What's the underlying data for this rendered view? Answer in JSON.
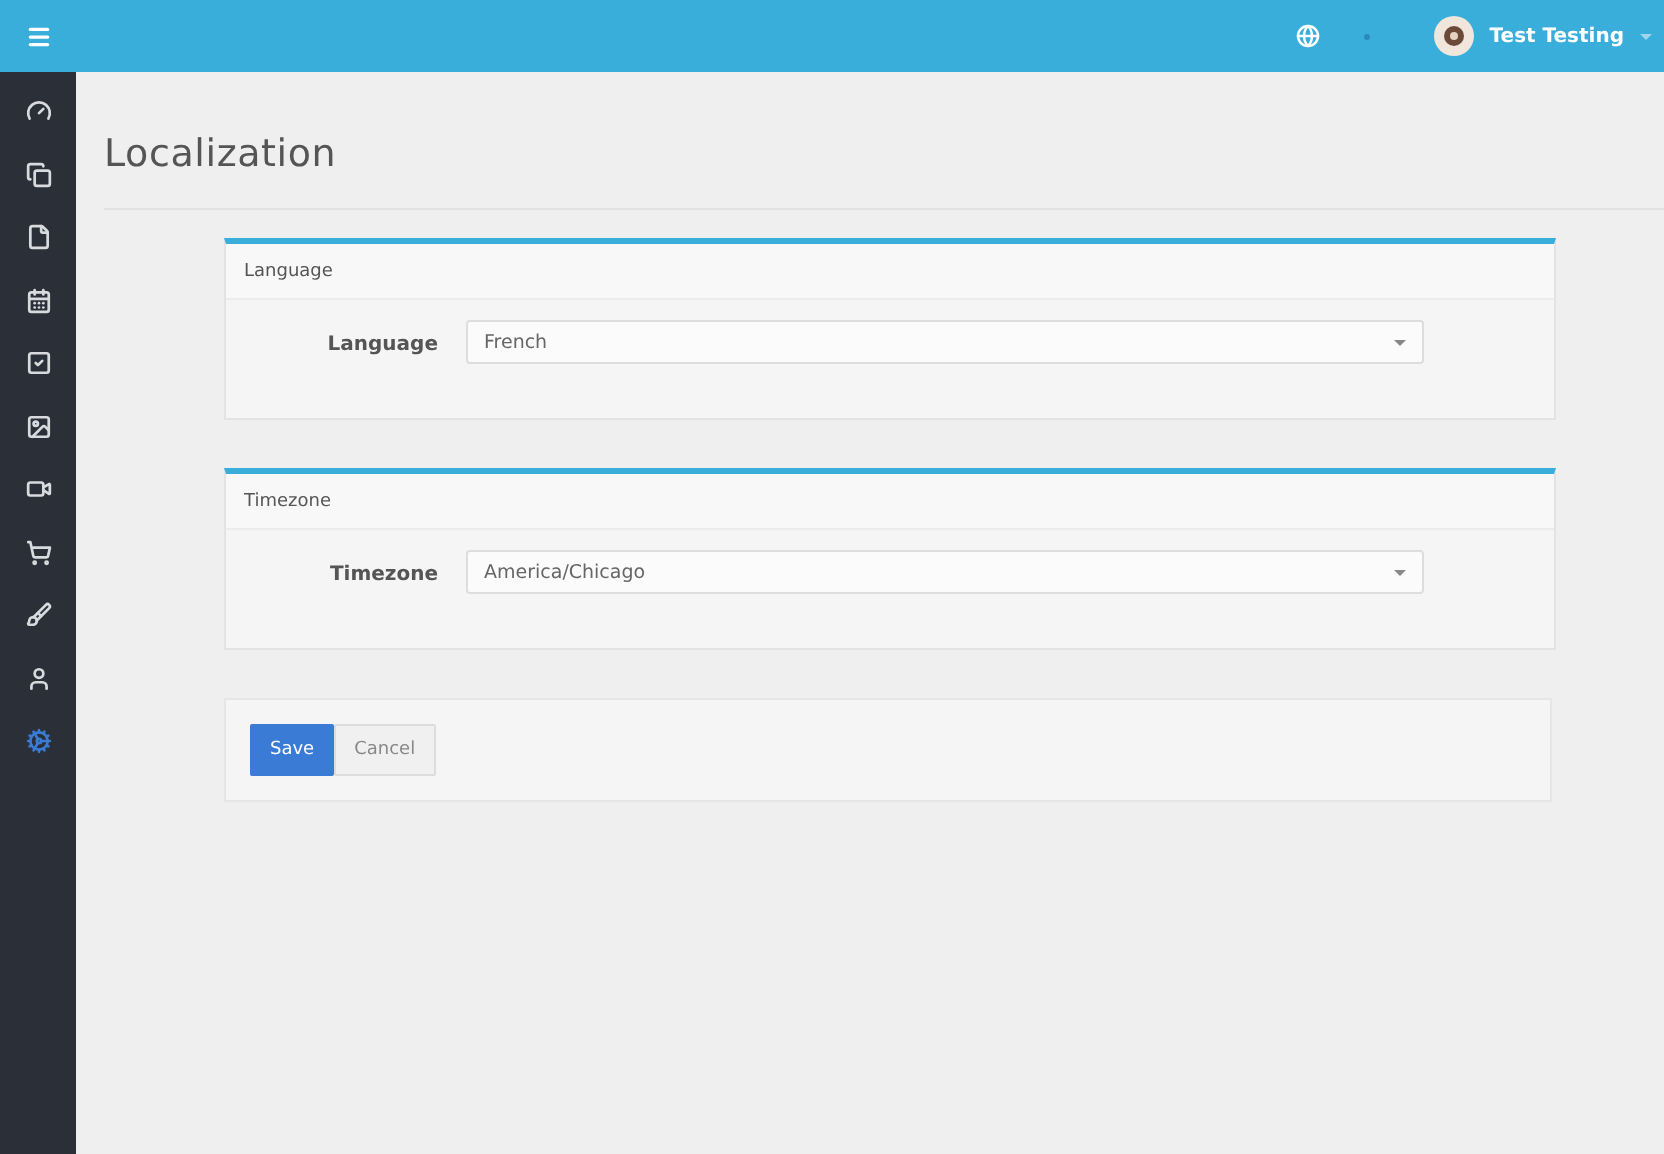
{
  "sidebar": {
    "items": [
      {
        "kind": "dashboard",
        "selected": false
      },
      {
        "kind": "copies",
        "selected": false
      },
      {
        "kind": "page",
        "selected": false
      },
      {
        "kind": "calendar",
        "selected": false
      },
      {
        "kind": "checklist",
        "selected": false
      },
      {
        "kind": "image",
        "selected": false
      },
      {
        "kind": "video",
        "selected": false
      },
      {
        "kind": "cart",
        "selected": false
      },
      {
        "kind": "brush",
        "selected": false
      },
      {
        "kind": "user",
        "selected": false
      },
      {
        "kind": "settings",
        "selected": true
      }
    ]
  },
  "topbar": {
    "user_name": "Test Testing"
  },
  "page": {
    "title": "Localization"
  },
  "panels": [
    {
      "title": "Language",
      "field_label": "Language",
      "value": "French"
    },
    {
      "title": "Timezone",
      "field_label": "Timezone",
      "value": "America/Chicago"
    }
  ],
  "actions": [
    {
      "label": "Save",
      "kind": "primary"
    },
    {
      "label": "Cancel",
      "kind": "default"
    }
  ]
}
